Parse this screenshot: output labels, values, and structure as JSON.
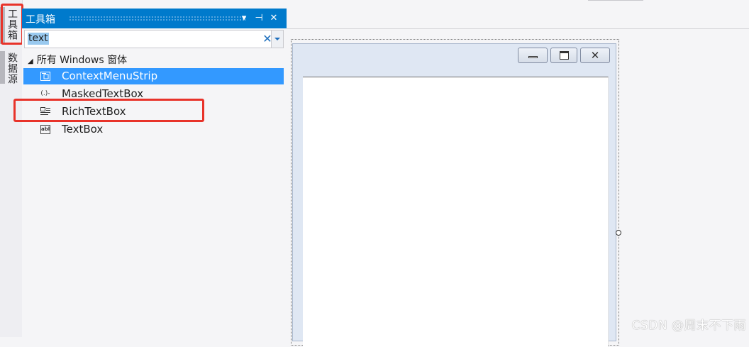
{
  "tabstrip": {
    "tabs": [
      {
        "label": "工具箱"
      },
      {
        "label": "数据源"
      }
    ]
  },
  "toolbox": {
    "title": "工具箱",
    "buttons": {
      "dropdown": "▾",
      "pin": "⊣",
      "close": "✕"
    },
    "search": {
      "value": "text",
      "clear": "✕"
    },
    "group": {
      "arrow": "◢",
      "label": "所有 Windows 窗体"
    },
    "items": [
      {
        "label": "ContextMenuStrip",
        "icon": "context-menu-strip-icon",
        "selected": true
      },
      {
        "label": "MaskedTextBox",
        "icon": "masked-textbox-icon",
        "icon_text": "(.)-",
        "selected": false
      },
      {
        "label": "RichTextBox",
        "icon": "rich-textbox-icon",
        "selected": false
      },
      {
        "label": "TextBox",
        "icon": "textbox-icon",
        "icon_text": "abl",
        "selected": false
      }
    ]
  },
  "designer": {
    "form_buttons": {
      "close": "✕"
    }
  },
  "watermark": "CSDN @周末不下雨",
  "colors": {
    "accent": "#007acc",
    "selection": "#3399ff",
    "highlight_box": "#e8332a"
  }
}
